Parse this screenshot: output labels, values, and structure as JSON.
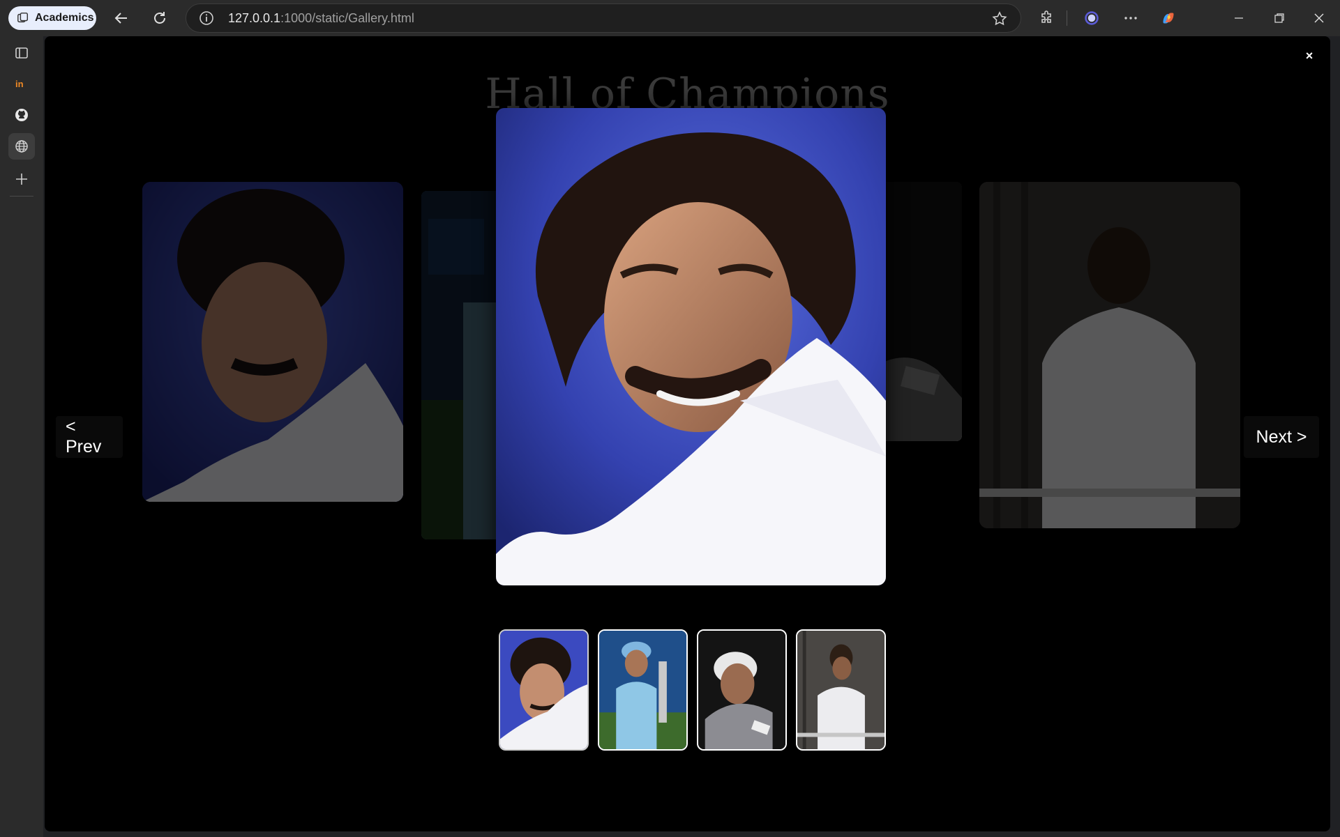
{
  "browser": {
    "profile_label": "Academics",
    "url_host": "127.0.0.1",
    "url_path": ":1000/static/Gallery.html",
    "icons": {
      "back": "arrow-left-icon",
      "reload": "reload-icon",
      "info": "info-icon",
      "favorite": "star-icon",
      "extensions": "puzzle-icon",
      "profile_avatar": "avatar-ring-icon",
      "more": "more-icon",
      "copilot": "copilot-icon",
      "minimize": "minimize-icon",
      "restore": "restore-icon",
      "close": "close-icon"
    }
  },
  "sidebar": {
    "items": [
      {
        "name": "tab-actions-icon"
      },
      {
        "name": "in-app-icon"
      },
      {
        "name": "github-icon"
      },
      {
        "name": "globe-icon"
      },
      {
        "name": "add-icon"
      }
    ]
  },
  "gallery": {
    "title": "Hall of Champions",
    "close_label": "×",
    "prev_label": "< Prev",
    "next_label": "Next >",
    "active_index": 0,
    "colors": {
      "background": "#000000",
      "thumb_border": "#ffffff"
    }
  }
}
